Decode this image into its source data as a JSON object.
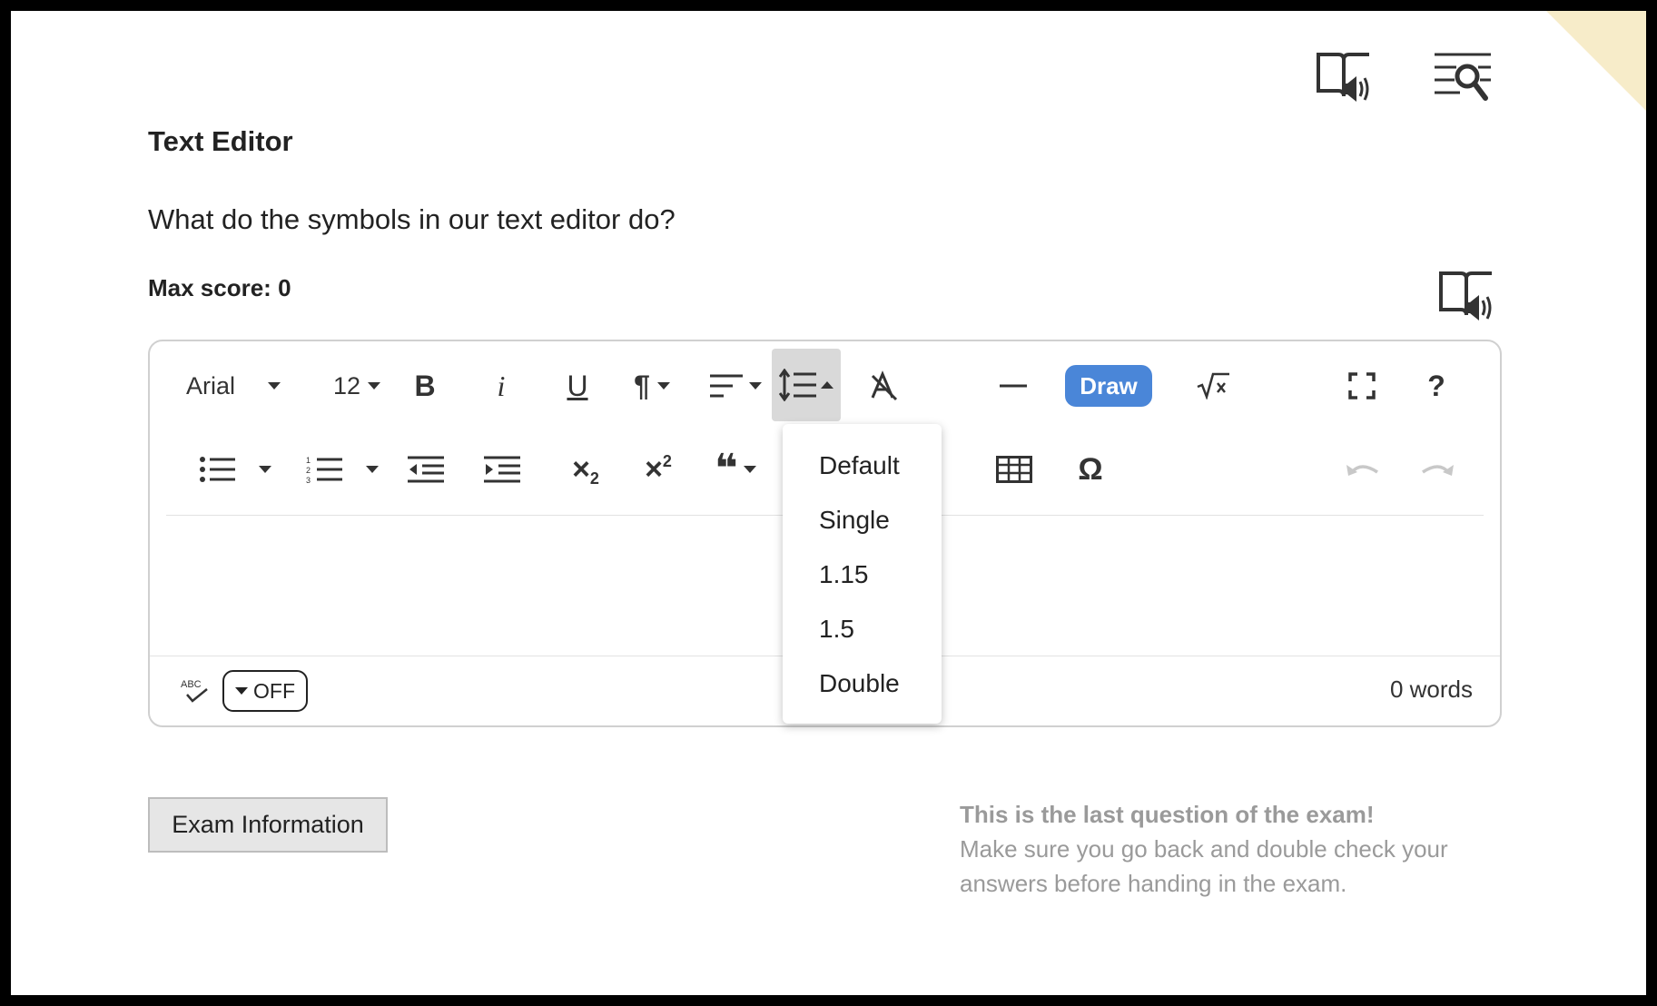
{
  "header": {
    "read_aloud_icon": "book-speaker-icon",
    "search_text_icon": "text-search-icon"
  },
  "question": {
    "title": "Text Editor",
    "text": "What do the symbols in our text editor do?",
    "max_score": "Max score: 0",
    "read_aloud_icon": "book-speaker-icon"
  },
  "toolbar": {
    "font_family": "Arial",
    "font_size": "12",
    "bold_label": "B",
    "italic_label": "i",
    "underline_label": "U",
    "paragraph_label": "¶",
    "draw_label": "Draw",
    "help_label": "?",
    "omega_label": "Ω",
    "subscript_x": "×",
    "subscript_n": "2",
    "superscript_x": "×",
    "superscript_n": "2",
    "quote_label": "❝"
  },
  "line_spacing_menu": {
    "options": [
      "Default",
      "Single",
      "1.15",
      "1.5",
      "Double"
    ]
  },
  "footer": {
    "spellcheck_label": "OFF",
    "word_count": "0 words"
  },
  "exam_info_button": "Exam Information",
  "last_question_note": {
    "title": "This is the last question of the exam!",
    "line1": "Make sure you go back and double check your",
    "line2": "answers before handing in the exam."
  },
  "colors": {
    "accent": "#4a86d8",
    "note_text": "#9a9a9a",
    "corner_fold": "#f7ecc9"
  }
}
